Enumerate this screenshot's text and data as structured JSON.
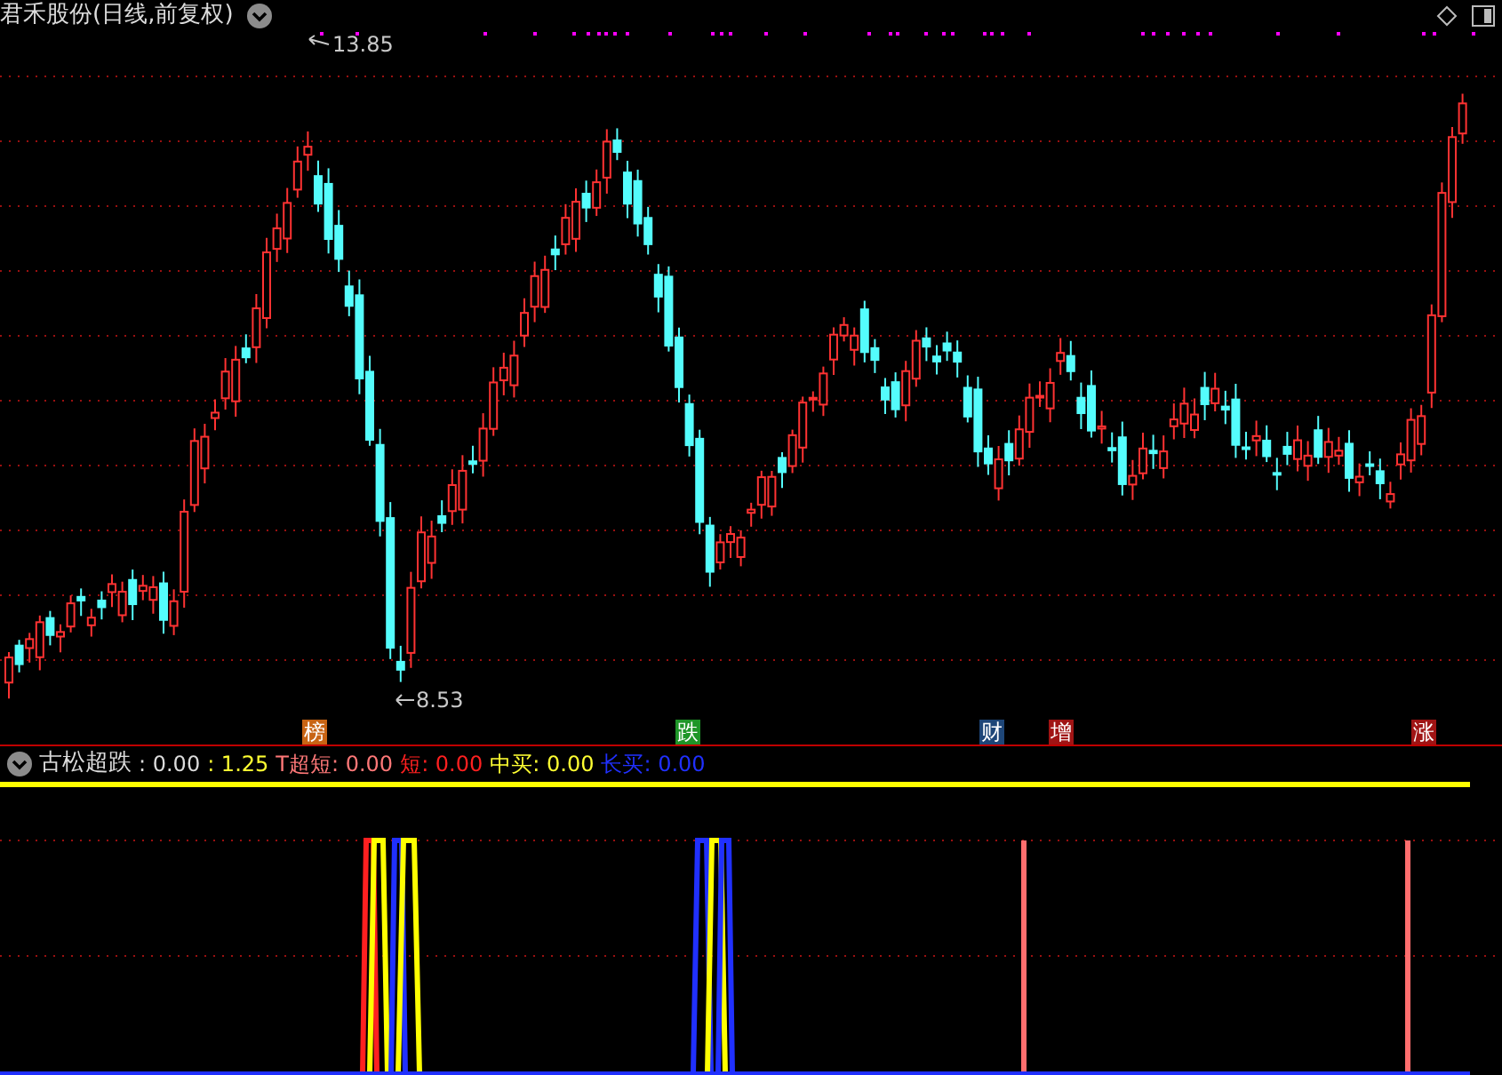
{
  "window": {
    "title": "君禾股份(日线,前复权)"
  },
  "price_chart": {
    "high_label": "13.85",
    "low_label": "8.53"
  },
  "event_markers": [
    {
      "label": "榜",
      "color": "#c86414"
    },
    {
      "label": "跌",
      "color": "#1e9628"
    },
    {
      "label": "财",
      "color": "#1e4678"
    },
    {
      "label": "增",
      "color": "#a01414"
    },
    {
      "label": "涨",
      "color": "#a01414"
    }
  ],
  "indicator": {
    "name": "古松超跌",
    "values": [
      {
        "text": ": 0.00",
        "kind": "base"
      },
      {
        "text": ": 1.25",
        "kind": "ratio"
      },
      {
        "text": "T超短: 0.00",
        "kind": "tshort"
      },
      {
        "text": "短: 0.00",
        "kind": "short"
      },
      {
        "text": "中买: 0.00",
        "kind": "midbuy"
      },
      {
        "text": "长买: 0.00",
        "kind": "longbuy"
      }
    ]
  }
}
